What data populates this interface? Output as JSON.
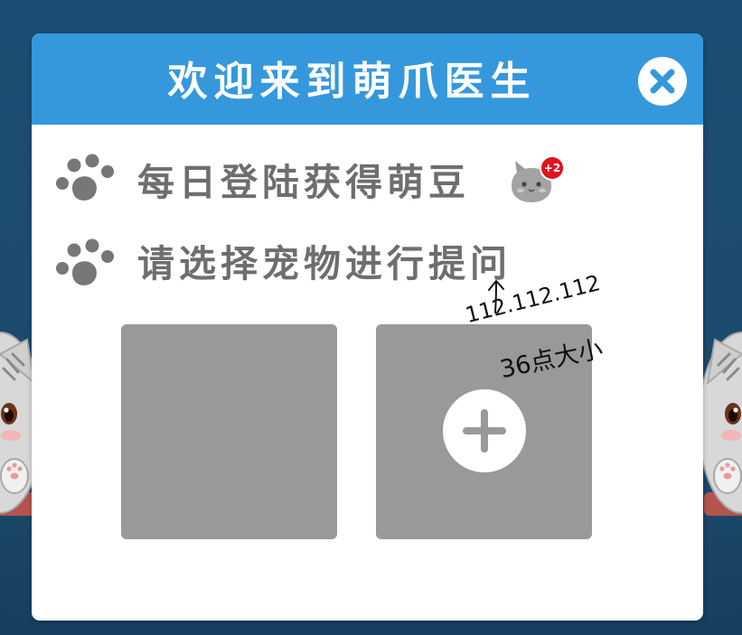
{
  "colors": {
    "background": "#1c4b6f",
    "header": "#3598dc",
    "row_text": "#6e6e6e",
    "pet_slot": "#999999",
    "badge": "#e0141c"
  },
  "dialog": {
    "title": "欢迎来到萌爪医生",
    "close_icon": "close-icon"
  },
  "rows": [
    {
      "icon": "paw-icon",
      "text": "每日登陆获得萌豆"
    },
    {
      "icon": "paw-icon",
      "text": "请选择宠物进行提问"
    }
  ],
  "bonus": {
    "icon": "bean-icon",
    "badge": "+2"
  },
  "pet_slots": {
    "add_icon": "plus-icon"
  },
  "annotation": {
    "color_note": "112.112.112",
    "size_note": "36点大小"
  }
}
